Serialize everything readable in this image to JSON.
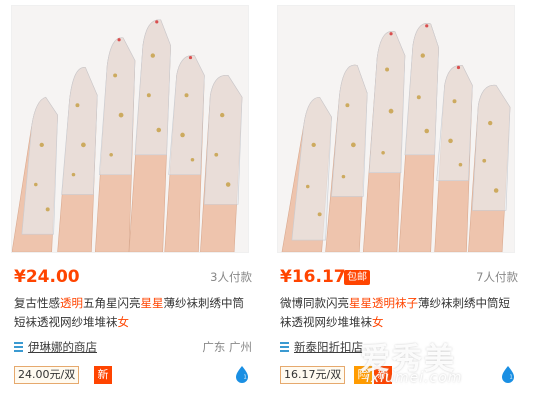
{
  "products": [
    {
      "price": "¥24.00",
      "badge": "",
      "sales": "3人付款",
      "title_parts": [
        "复古性感",
        "透明",
        "五角星闪亮",
        "星星",
        "薄纱袜刺绣中筒短袜透视网纱堆堆袜",
        "女"
      ],
      "shop": "伊琳娜的商店",
      "location": "广东 广州",
      "unit_price": "24.00元/双",
      "tags": [
        "新"
      ],
      "image_icon": "lace-sheer-socks-photo",
      "ww_icon": "wangwang-chat-icon"
    },
    {
      "price": "¥16.17",
      "badge": "包邮",
      "sales": "7人付款",
      "title_parts": [
        "微博同款闪亮",
        "星星透明袜子",
        "薄纱袜刺绣中筒短袜透视网纱堆堆袜",
        "女"
      ],
      "shop": "新泰阳折扣店",
      "location": "",
      "unit_price": "16.17元/双",
      "tags": [
        "险",
        "新"
      ],
      "image_icon": "lace-sheer-socks-photo",
      "ww_icon": "wangwang-chat-icon"
    }
  ],
  "watermark": {
    "main": "爱秀美",
    "sub": "ixiumei.com"
  },
  "colors": {
    "accent": "#ff4400",
    "shop_link": "#3b9ad1",
    "tag_orange": "#ff9b00"
  }
}
